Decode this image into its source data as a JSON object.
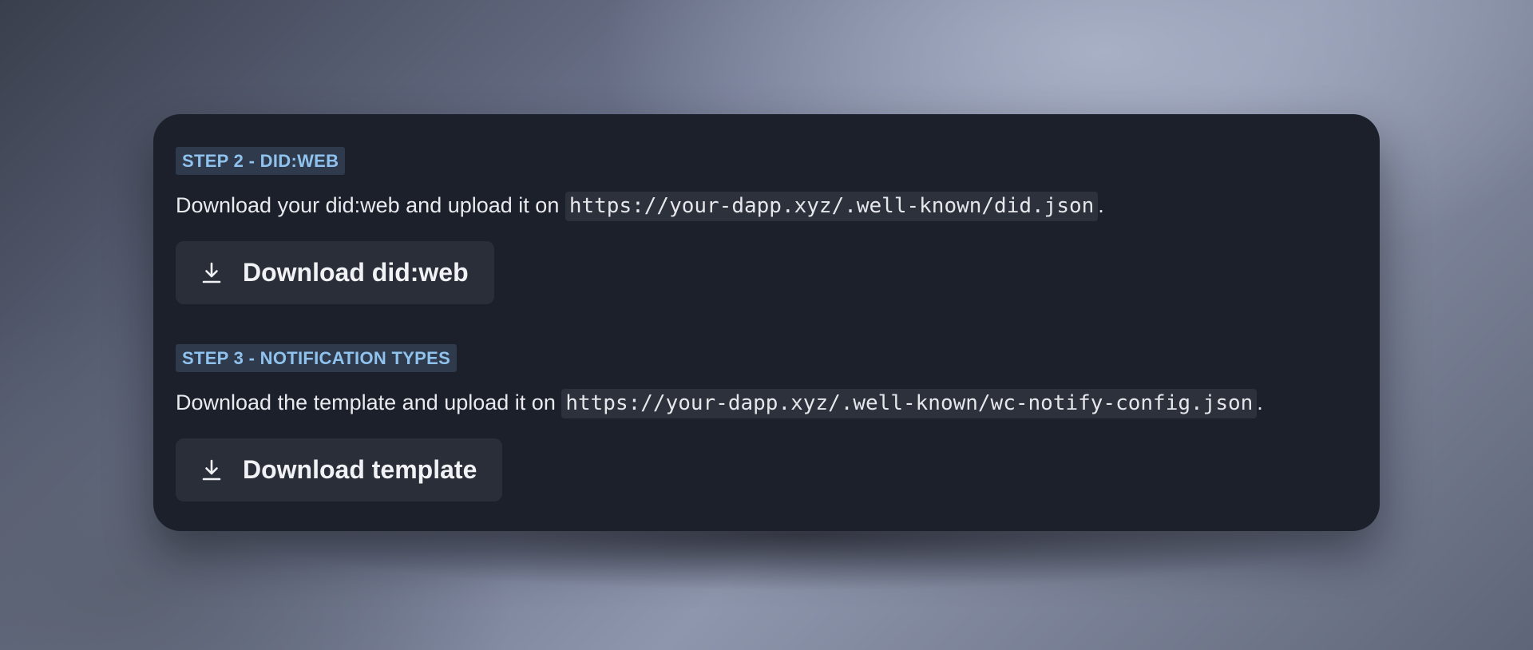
{
  "steps": [
    {
      "badge": "STEP 2 - DID:WEB",
      "description_before": "Download your did:web and upload it on ",
      "code": "https://your-dapp.xyz/.well-known/did.json",
      "description_after": ".",
      "button_label": "Download did:web",
      "button_icon": "download-icon"
    },
    {
      "badge": "STEP 3 - NOTIFICATION TYPES",
      "description_before": "Download the template and upload it on ",
      "code": "https://your-dapp.xyz/.well-known/wc-notify-config.json",
      "description_after": ".",
      "button_label": "Download template",
      "button_icon": "download-icon"
    }
  ],
  "colors": {
    "card_background": "#1c202b",
    "badge_background": "#2f3a4c",
    "badge_text": "#8fc3ee",
    "button_background": "#2a2e39",
    "code_background": "#2d313c"
  }
}
